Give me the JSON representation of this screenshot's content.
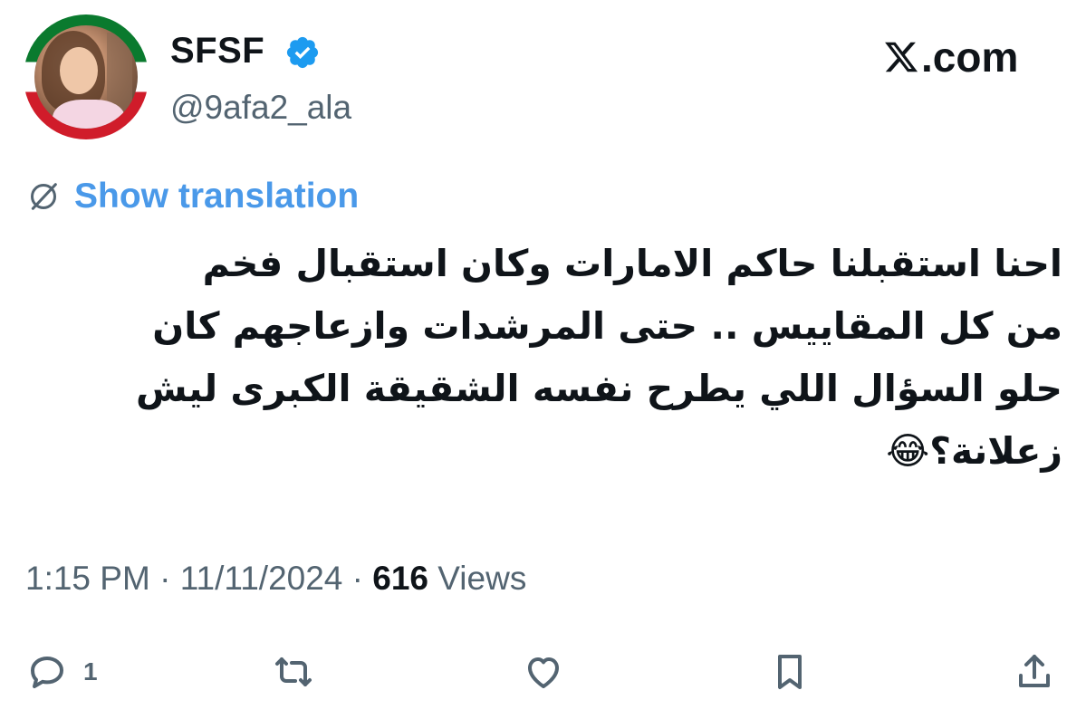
{
  "profile": {
    "display_name": "SFSF",
    "handle": "@9afa2_ala",
    "verified": true
  },
  "site": {
    "label": ".com",
    "logo": "x-logo"
  },
  "translation": {
    "label": "Show translation",
    "icon": "globe-slash-icon"
  },
  "tweet": {
    "lines": [
      "احنا استقبلنا حاكم الامارات وكان استقبال فخم",
      "من كل المقاييس .. حتى المرشدات وازعاجهم كان",
      "حلو السؤال اللي يطرح نفسه الشقيقة الكبرى ليش",
      "زعلانة؟😂"
    ]
  },
  "meta": {
    "time": "1:15 PM",
    "separator": "·",
    "date": "11/11/2024",
    "views_count": "616",
    "views_label": "Views"
  },
  "actions": {
    "reply_count": "1",
    "icons": [
      "reply-icon",
      "retweet-icon",
      "like-icon",
      "bookmark-icon",
      "share-icon"
    ]
  },
  "colors": {
    "text": "#0f1419",
    "secondary": "#536471",
    "link": "#4a99e9",
    "verified": "#1d9bf0"
  }
}
